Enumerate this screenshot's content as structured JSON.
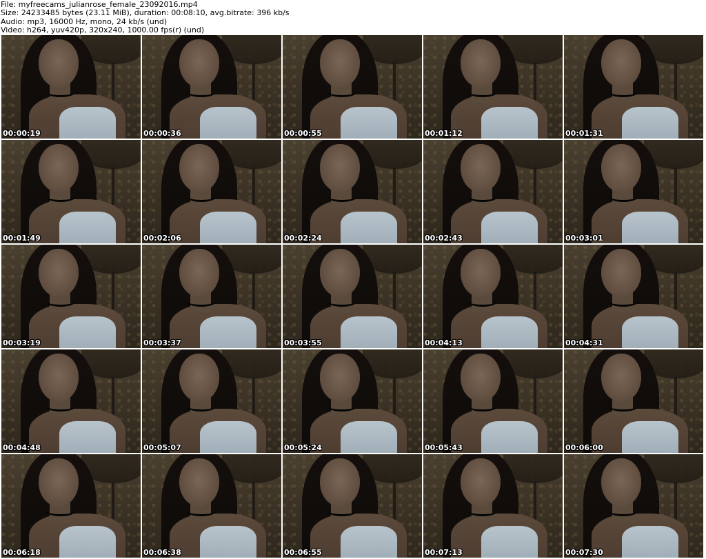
{
  "header": {
    "file_line": "File: myfreecams_julianrose_female_23092016.mp4",
    "size_line": "Size: 24233485 bytes (23.11 MiB), duration: 00:08:10, avg.bitrate: 396 kb/s",
    "audio_line": "Audio: mp3, 16000 Hz, mono, 24 kb/s (und)",
    "video_line": "Video: h264, yuv420p, 320x240, 1000.00 fps(r) (und)"
  },
  "thumbnails": [
    {
      "timestamp": "00:00:19"
    },
    {
      "timestamp": "00:00:36"
    },
    {
      "timestamp": "00:00:55"
    },
    {
      "timestamp": "00:01:12"
    },
    {
      "timestamp": "00:01:31"
    },
    {
      "timestamp": "00:01:49"
    },
    {
      "timestamp": "00:02:06"
    },
    {
      "timestamp": "00:02:24"
    },
    {
      "timestamp": "00:02:43"
    },
    {
      "timestamp": "00:03:01"
    },
    {
      "timestamp": "00:03:19"
    },
    {
      "timestamp": "00:03:37"
    },
    {
      "timestamp": "00:03:55"
    },
    {
      "timestamp": "00:04:13"
    },
    {
      "timestamp": "00:04:31"
    },
    {
      "timestamp": "00:04:48"
    },
    {
      "timestamp": "00:05:07"
    },
    {
      "timestamp": "00:05:24"
    },
    {
      "timestamp": "00:05:43"
    },
    {
      "timestamp": "00:06:00"
    },
    {
      "timestamp": "00:06:18"
    },
    {
      "timestamp": "00:06:38"
    },
    {
      "timestamp": "00:06:55"
    },
    {
      "timestamp": "00:07:13"
    },
    {
      "timestamp": "00:07:30"
    }
  ]
}
